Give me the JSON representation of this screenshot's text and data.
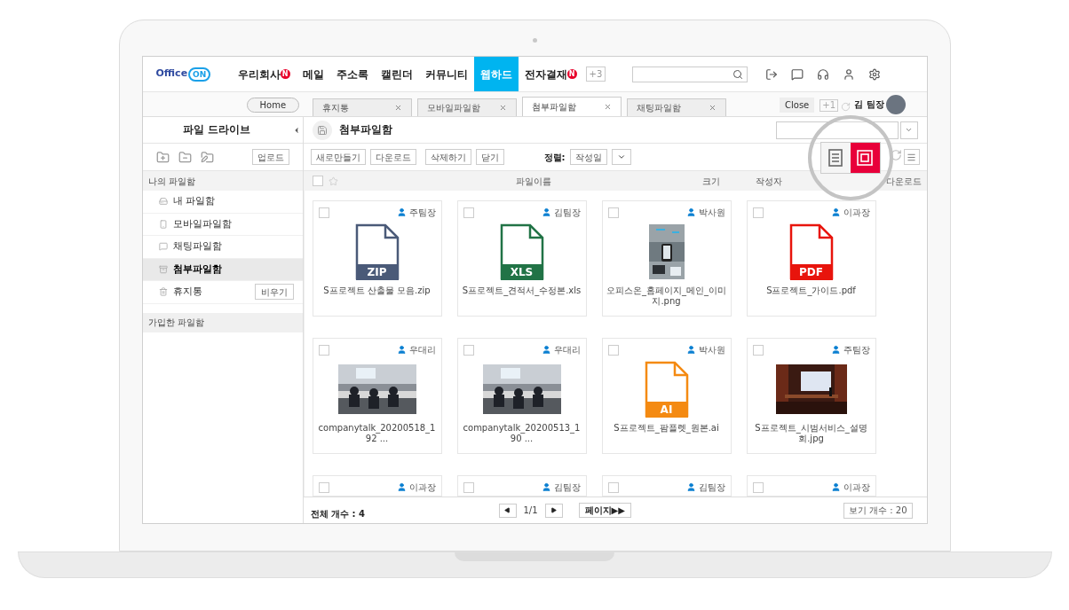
{
  "logo": {
    "text": "Office",
    "mark": "ON"
  },
  "nav": [
    {
      "label": "우리회사",
      "badge": "N",
      "selected": false
    },
    {
      "label": "메일",
      "selected": false
    },
    {
      "label": "주소록",
      "selected": false
    },
    {
      "label": "캘린더",
      "selected": false
    },
    {
      "label": "커뮤니티",
      "selected": false
    },
    {
      "label": "웹하드",
      "selected": true
    },
    {
      "label": "전자결재",
      "badge": "N",
      "selected": false
    }
  ],
  "nav_more": "+3",
  "tab_bar": {
    "home": "Home",
    "tabs": [
      {
        "label": "휴지통",
        "selected": false
      },
      {
        "label": "모바일파일함",
        "selected": false
      },
      {
        "label": "첨부파일함",
        "selected": true
      },
      {
        "label": "채팅파일함",
        "selected": false
      }
    ],
    "close": "Close",
    "count": "+1",
    "user_name": "김 팀장"
  },
  "sidebar": {
    "title": "파일 드라이브",
    "upload": "업로드",
    "section": "나의 파일함",
    "items": [
      {
        "label": "내 파일함",
        "selected": false
      },
      {
        "label": "모바일파일함",
        "selected": false
      },
      {
        "label": "채팅파일함",
        "selected": false
      },
      {
        "label": "첨부파일함",
        "selected": true
      },
      {
        "label": "휴지통",
        "selected": false,
        "action": "비우기"
      }
    ],
    "section_2": "가입한 파일함"
  },
  "main": {
    "title": "첨부파일함",
    "buttons": [
      "새로만들기",
      "다운로드",
      "삭제하기",
      "닫기"
    ],
    "sort_label": "정렬:",
    "sort_value": "작성일",
    "view_modes": [
      {
        "kind": "list",
        "selected": false
      },
      {
        "kind": "grid",
        "selected": true
      }
    ],
    "select_all_checked": false,
    "columns": [
      "파일이름",
      "크기",
      "작성자",
      "다운로드"
    ],
    "files": [
      {
        "owner": "주팀장",
        "name": "S프로젝트 산출물 모음.zip",
        "kind": "file",
        "type": "ZIP",
        "color": "#4a5a78",
        "checked": false
      },
      {
        "owner": "김팀장",
        "name": "S프로젝트_견적서_수정본.xls",
        "kind": "file",
        "type": "XLS",
        "color": "#217346",
        "checked": false
      },
      {
        "owner": "박사원",
        "name": "오피스온_홈페이지_메인_이미지.png",
        "kind": "picture",
        "checked": false
      },
      {
        "owner": "이과장",
        "name": "S프로젝트_가이드.pdf",
        "kind": "file",
        "type": "PDF",
        "color": "#e8140c",
        "checked": false
      },
      {
        "owner": "우대리",
        "name": "companytalk_20200518_192 ...",
        "kind": "picture",
        "checked": false
      },
      {
        "owner": "우대리",
        "name": "companytalk_20200513_190 ...",
        "kind": "picture",
        "checked": false
      },
      {
        "owner": "박사원",
        "name": "S프로젝트_팜플렛_원본.ai",
        "kind": "file",
        "type": "AI",
        "color": "#f48a12",
        "checked": false
      },
      {
        "owner": "주팀장",
        "name": "S프로젝트_시범서비스_설명회.jpg",
        "kind": "picture",
        "checked": false
      },
      {
        "owner": "이과장",
        "kind": "partial",
        "checked": false
      },
      {
        "owner": "김팀장",
        "kind": "partial",
        "checked": false
      },
      {
        "owner": "김팀장",
        "kind": "partial",
        "checked": false
      },
      {
        "owner": "이과장",
        "kind": "partial",
        "checked": false
      }
    ],
    "total": "전체 개수 : 4",
    "page": "1/1",
    "page_jump": "페이지▶▶",
    "per_page": "보기 개수 : 20"
  }
}
